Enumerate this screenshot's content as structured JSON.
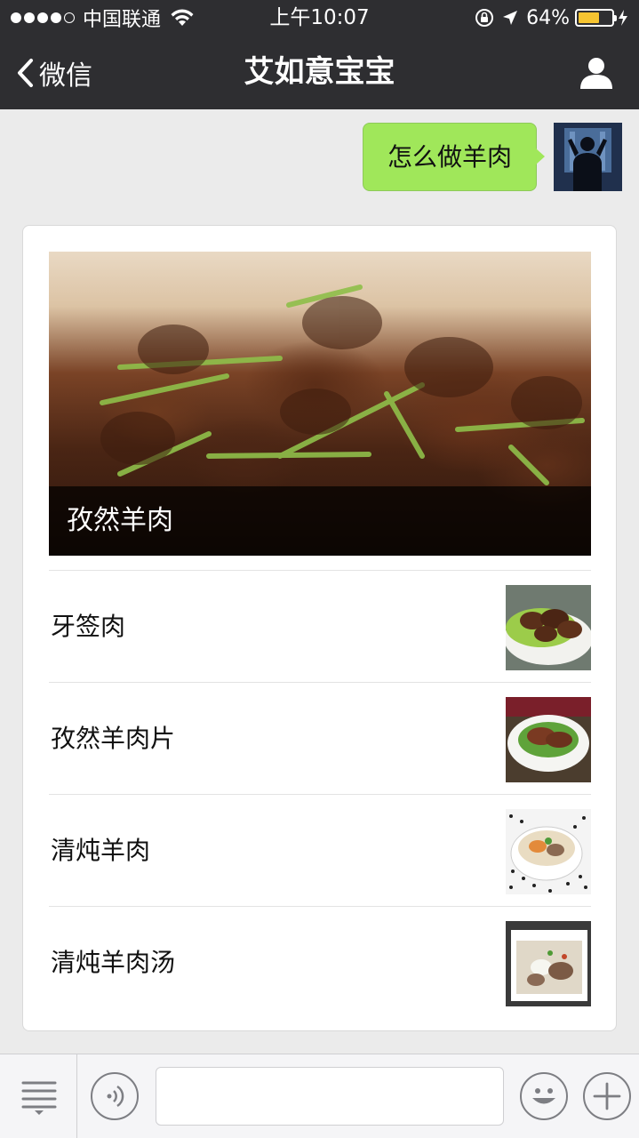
{
  "status_bar": {
    "carrier": "中国联通",
    "time": "上午10:07",
    "battery_percent": "64%",
    "battery_level": 0.64,
    "signal_bars_filled": 4,
    "signal_bars_total": 5
  },
  "nav": {
    "back_label": "微信",
    "title": "艾如意宝宝"
  },
  "chat": {
    "user_message": "怎么做羊肉",
    "card": {
      "hero_title": "孜然羊肉",
      "items": [
        {
          "label": "牙签肉"
        },
        {
          "label": "孜然羊肉片"
        },
        {
          "label": "清炖羊肉"
        },
        {
          "label": "清炖羊肉汤"
        }
      ]
    }
  },
  "input_bar": {
    "text": ""
  },
  "colors": {
    "nav_bg": "#2e2e31",
    "bubble_green": "#a0e75a",
    "battery_yellow": "#f6c431"
  },
  "icons": {
    "back": "chevron-left-icon",
    "profile": "person-icon",
    "menu": "list-menu-icon",
    "voice": "voice-icon",
    "emoji": "smiley-icon",
    "more": "plus-icon"
  }
}
